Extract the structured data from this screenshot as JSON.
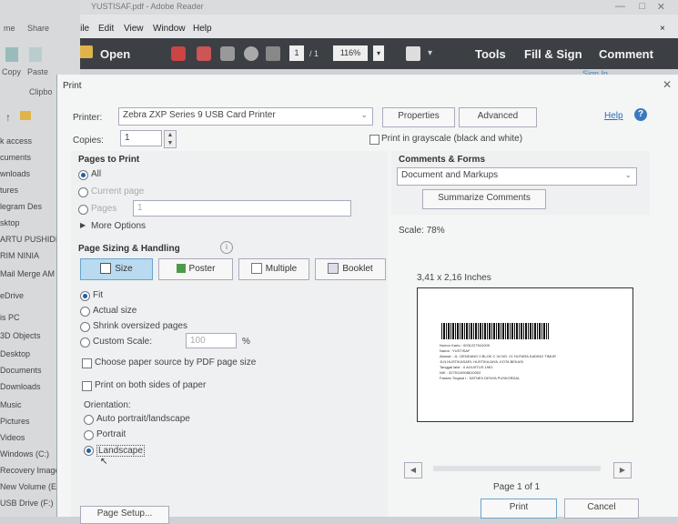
{
  "window": {
    "title": "YUSTISAF.pdf - Adobe Reader"
  },
  "menubar": {
    "items": [
      "File",
      "Edit",
      "View",
      "Window",
      "Help"
    ]
  },
  "toolbar": {
    "open_label": "Open",
    "page_current": "1",
    "page_total": "/ 1",
    "zoom": "116%",
    "tools_label": "Tools",
    "fill_sign_label": "Fill & Sign",
    "comment_label": "Comment",
    "signin_label": "Sign In"
  },
  "explorer": {
    "tabs": [
      "me",
      "Share"
    ],
    "ribbon": [
      "Copy",
      "Paste",
      "Clipbo"
    ],
    "nav_items": [
      "k access",
      "cuments",
      "wnloads",
      "tures",
      "legram Des",
      "sktop",
      "ARTU PUSHIDI",
      "RIM NINIA",
      "Mail Merge AM",
      "eDrive",
      "is PC",
      "3D Objects",
      "Desktop",
      "Documents",
      "Downloads",
      "Music",
      "Pictures",
      "Videos",
      "Windows (C:)",
      "Recovery Image",
      "New Volume (E:",
      "USB Drive (F:)"
    ]
  },
  "dialog": {
    "title": "Print",
    "printer_label": "Printer:",
    "printer_value": "Zebra ZXP Series 9 USB Card Printer",
    "properties_label": "Properties",
    "advanced_label": "Advanced",
    "help_label": "Help",
    "copies_label": "Copies:",
    "copies_value": "1",
    "grayscale_label": "Print in grayscale (black and white)",
    "pages_to_print": {
      "title": "Pages to Print",
      "all": "All",
      "current_page": "Current page",
      "pages": "Pages",
      "pages_value": "1",
      "more_options": "More Options"
    },
    "comments_forms": {
      "title": "Comments & Forms",
      "selected": "Document and Markups",
      "summarize_label": "Summarize Comments"
    },
    "scale_text": "Scale: 78%",
    "page_sizing": {
      "title": "Page Sizing & Handling",
      "tabs": [
        "Size",
        "Poster",
        "Multiple",
        "Booklet"
      ],
      "fit": "Fit",
      "actual_size": "Actual size",
      "shrink": "Shrink oversized pages",
      "custom_scale": "Custom Scale:",
      "custom_scale_value": "100",
      "percent": "%",
      "choose_paper": "Choose paper source by PDF page size",
      "both_sides": "Print on both sides of paper",
      "orientation": "Orientation:",
      "auto": "Auto portrait/landscape",
      "portrait": "Portrait",
      "landscape": "Landscape"
    },
    "preview": {
      "size_text": "3,41 x 2,16 Inches",
      "card_lines": [
        "Nomor Kartu : 0031227541009",
        "Nama : YUSTISAF",
        "Alamat : JL. DENDANG II BLOK C 34 NO. 21 HUTARA KADING TIMUR",
        "JLN HUSTIKASARI, HUSTIKAJAYA, KOTA BEKASI",
        "Tanggal lahir : 0 AGUSTUS 1961",
        "NIK : 3275110908610002",
        "Faskes Tingkat I : SATNEX DENYA PUSKORDAL"
      ],
      "page_text": "Page 1 of 1"
    },
    "page_setup_label": "Page Setup...",
    "print_label": "Print",
    "cancel_label": "Cancel"
  }
}
